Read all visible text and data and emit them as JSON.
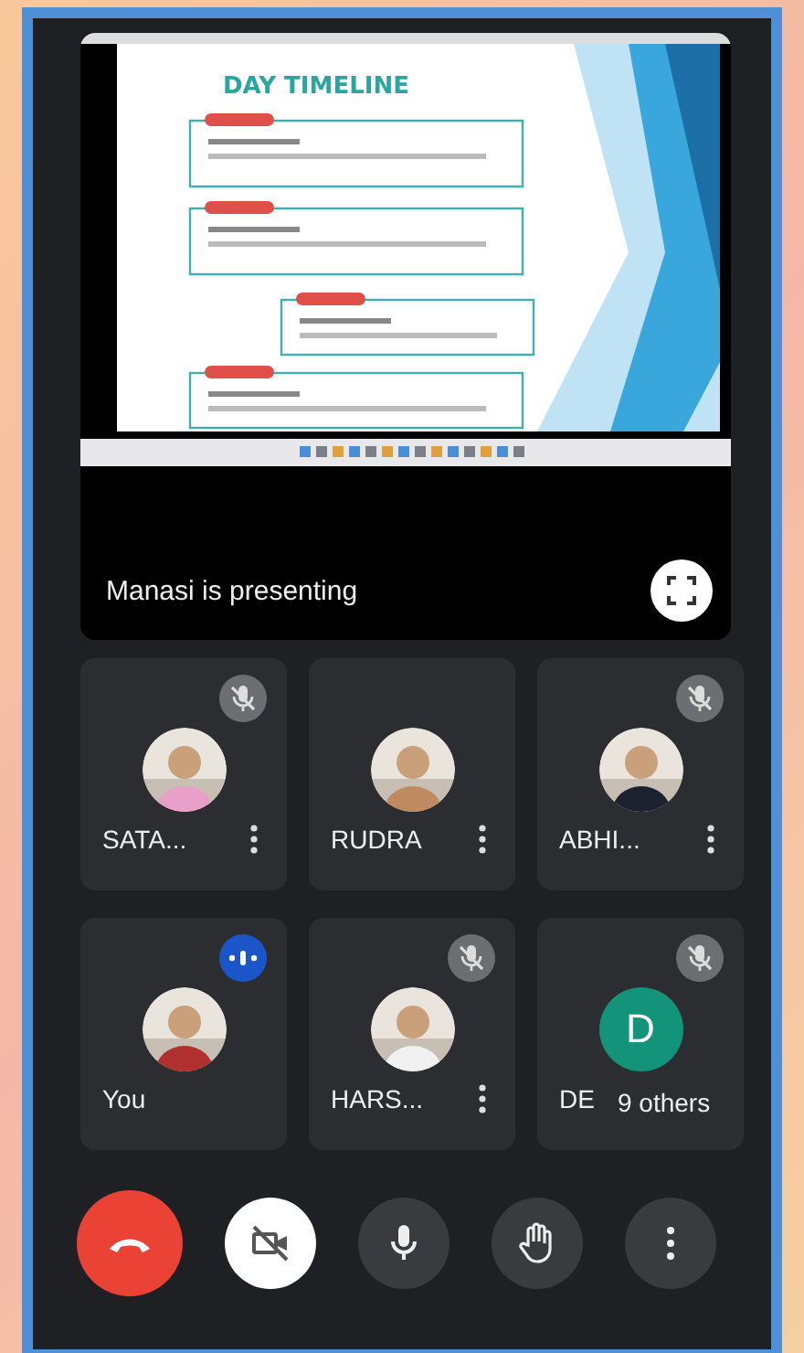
{
  "presentation": {
    "slide_title": "DAY TIMELINE",
    "caption": "Manasi is presenting"
  },
  "tiles": [
    {
      "name": "SATA...",
      "muted": true,
      "speaking": false,
      "menu": true
    },
    {
      "name": "RUDRA",
      "muted": false,
      "speaking": false,
      "menu": true
    },
    {
      "name": "ABHI...",
      "muted": true,
      "speaking": false,
      "menu": true
    },
    {
      "name": "You",
      "muted": false,
      "speaking": true,
      "menu": false
    },
    {
      "name": "HARS...",
      "muted": true,
      "speaking": false,
      "menu": true
    },
    {
      "name": "DE",
      "muted": true,
      "speaking": false,
      "menu": false,
      "avatar": {
        "kind": "letter",
        "letter": "D",
        "color": "#12937a"
      },
      "others": "9 others"
    }
  ],
  "controls": [
    {
      "kind": "hangup"
    },
    {
      "kind": "camera",
      "on": false
    },
    {
      "kind": "mic",
      "on": true
    },
    {
      "kind": "hand"
    },
    {
      "kind": "more"
    }
  ]
}
